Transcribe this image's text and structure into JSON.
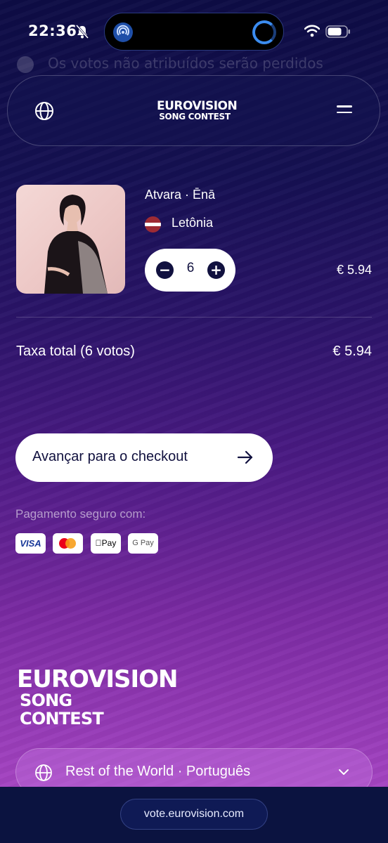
{
  "status_bar": {
    "time": "22:36",
    "icons": [
      "bell-muted-icon",
      "airdrop-icon",
      "activity-ring-icon",
      "wifi-icon",
      "battery-icon"
    ]
  },
  "ghost_text": "Os votos não atribuídos serão perdidos",
  "header": {
    "globe_icon": "globe-icon",
    "logo_line1": "EUROVISION",
    "logo_line2": "SONG CONTEST",
    "menu_icon": "hamburger-menu-icon"
  },
  "cart_item": {
    "artist_song": "Atvara · Ēnā",
    "country": "Letônia",
    "flag_colors": [
      "#9e2b34",
      "#ffffff"
    ],
    "quantity": "6",
    "price": "€ 5.94"
  },
  "summary": {
    "total_label": "Taxa total (6 votos)",
    "total_value": "€ 5.94"
  },
  "checkout": {
    "button_label": "Avançar para o checkout",
    "arrow_icon": "arrow-right-icon"
  },
  "payment": {
    "secure_label": "Pagamento seguro com:",
    "methods": [
      "VISA",
      "Mastercard",
      "Apple Pay",
      "G Pay"
    ],
    "apple_pay_label": "Pay",
    "gpay_label": "G Pay"
  },
  "footer": {
    "logo_line1": "EUROVISION",
    "logo_line2": "SONG CONTEST",
    "region_label": "Rest of the World · Português"
  },
  "browser": {
    "url": "vote.eurovision.com"
  },
  "colors": {
    "accent_dark": "#11113f",
    "bg_top": "#0d0c45",
    "bg_bottom": "#a544c2"
  }
}
